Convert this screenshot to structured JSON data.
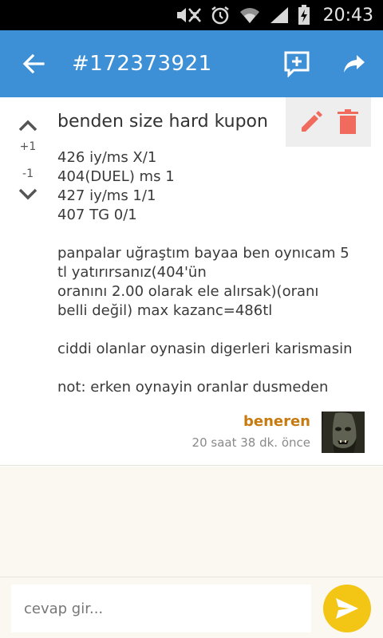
{
  "status_bar": {
    "time": "20:43",
    "icons": [
      "mute-icon",
      "alarm-icon",
      "wifi-icon",
      "signal-icon",
      "battery-charging-icon"
    ]
  },
  "app_bar": {
    "title": "#172373921",
    "color": "#3d8fd6",
    "icons": [
      "back-arrow-icon",
      "add-comment-icon",
      "share-icon"
    ]
  },
  "post": {
    "title": "benden size hard kupon",
    "votes": {
      "up": "+1",
      "down": "-1"
    },
    "body": [
      "426 iy/ms X/1\n404(DUEL) ms 1\n427 iy/ms 1/1\n407 TG 0/1",
      "panpalar uğraştım bayaa ben oynıcam 5 tl yatırırsanız(404'ün\noranını 2.00 olarak ele alırsak)(oranı belli değil) max kazanc=486tl",
      "ciddi olanlar oynasin digerleri karismasin",
      "not: erken oynayin oranlar dusmeden"
    ],
    "author": "beneren",
    "timestamp": "20 saat 38 dk. önce",
    "author_color": "#c77a10",
    "action_icons": [
      "edit-icon",
      "delete-icon"
    ],
    "action_color": "#f06b5e"
  },
  "reply": {
    "placeholder": "cevap gir...",
    "send_color": "#f3c515"
  }
}
